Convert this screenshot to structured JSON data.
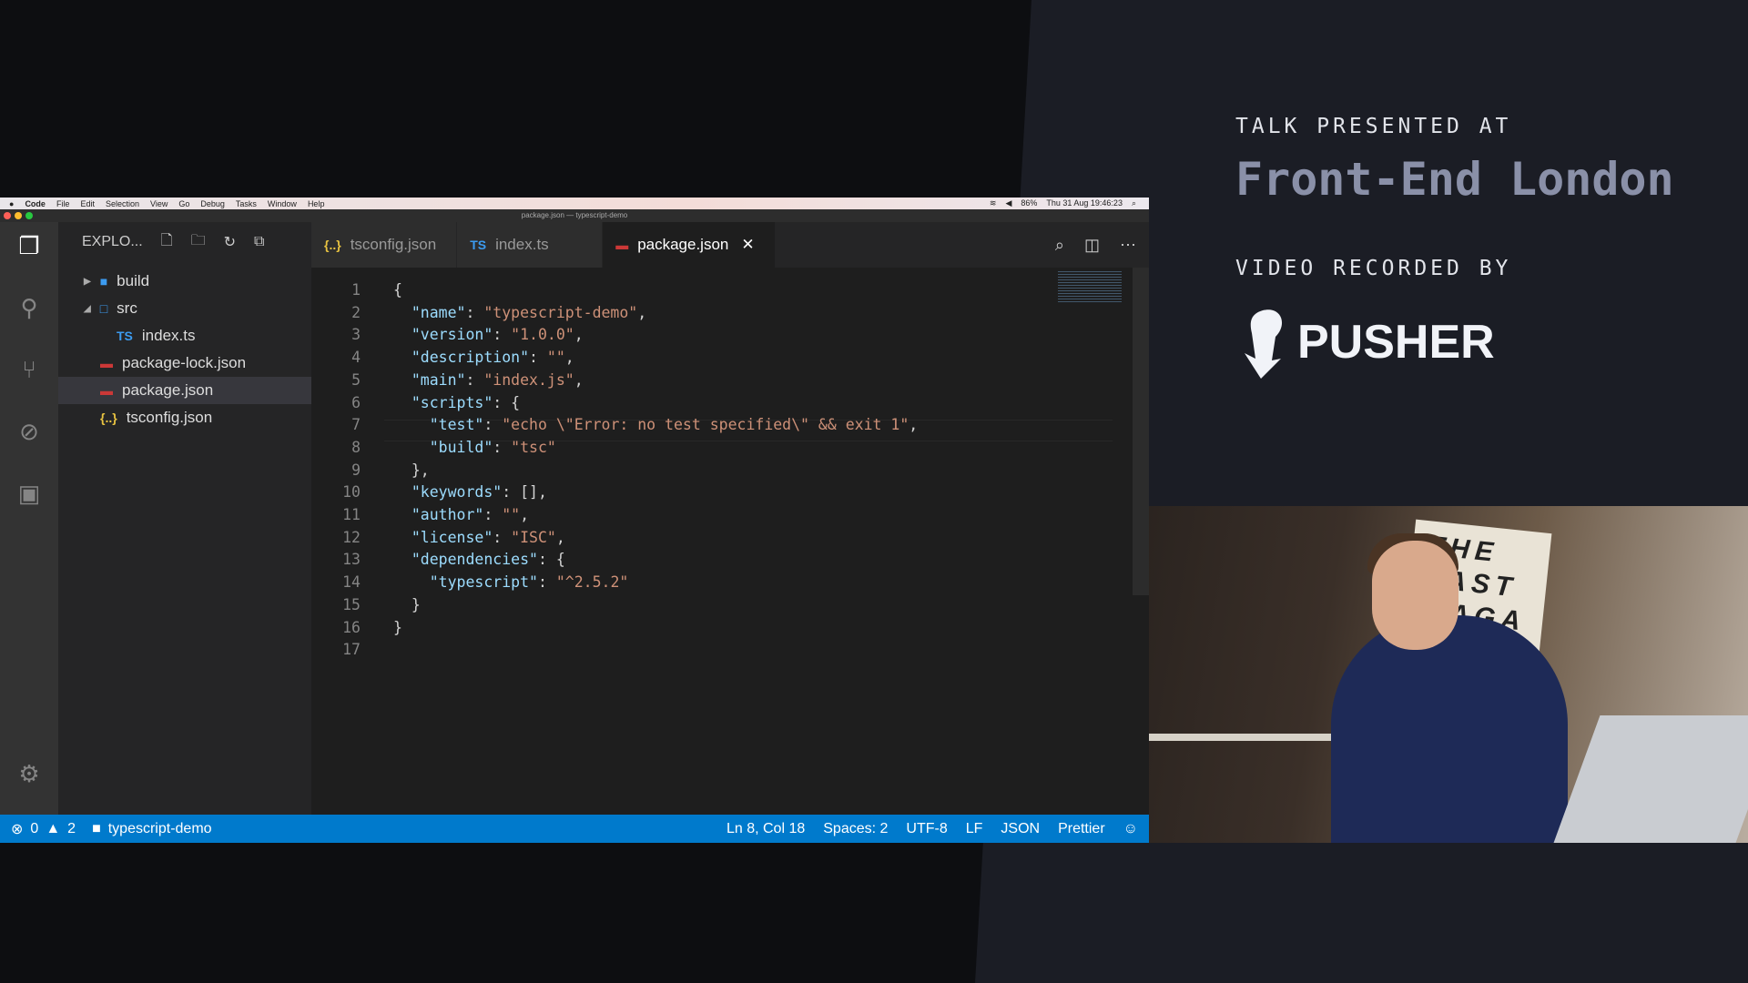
{
  "menubar": {
    "items": [
      "Code",
      "File",
      "Edit",
      "Selection",
      "View",
      "Go",
      "Debug",
      "Tasks",
      "Window",
      "Help"
    ],
    "battery": "86%",
    "clock": "Thu 31 Aug  19:46:23"
  },
  "window_title": "package.json — typescript-demo",
  "sidebar": {
    "title": "EXPLO...",
    "items": [
      {
        "label": "build",
        "icon": "folder-icon",
        "type": "folder",
        "expanded": false
      },
      {
        "label": "src",
        "icon": "folder-open-icon",
        "type": "folder",
        "expanded": true
      },
      {
        "label": "index.ts",
        "icon": "TS",
        "type": "file"
      },
      {
        "label": "package-lock.json",
        "icon": "npm-icon",
        "type": "file"
      },
      {
        "label": "package.json",
        "icon": "npm-icon",
        "type": "file",
        "selected": true
      },
      {
        "label": "tsconfig.json",
        "icon": "{..}",
        "type": "file"
      }
    ]
  },
  "tabs": [
    {
      "label": "tsconfig.json",
      "icon": "{..}"
    },
    {
      "label": "index.ts",
      "icon": "TS"
    },
    {
      "label": "package.json",
      "icon": "npm-icon",
      "active": true
    }
  ],
  "code": [
    "{",
    "  \"name\": \"typescript-demo\",",
    "  \"version\": \"1.0.0\",",
    "  \"description\": \"\",",
    "  \"main\": \"index.js\",",
    "  \"scripts\": {",
    "    \"test\": \"echo \\\"Error: no test specified\\\" && exit 1\",",
    "    \"build\": \"tsc\"",
    "  },",
    "  \"keywords\": [],",
    "  \"author\": \"\",",
    "  \"license\": \"ISC\",",
    "  \"dependencies\": {",
    "    \"typescript\": \"^2.5.2\"",
    "  }",
    "}",
    ""
  ],
  "status": {
    "errors": "0",
    "warnings": "2",
    "folder": "typescript-demo",
    "position": "Ln 8, Col 18",
    "spaces": "Spaces: 2",
    "encoding": "UTF-8",
    "eol": "LF",
    "language": "JSON",
    "formatter": "Prettier"
  },
  "overlay": {
    "talk_label": "TALK PRESENTED AT",
    "event": "Front-End London",
    "video_label": "VIDEO RECORDED BY",
    "sponsor": "PUSHER"
  },
  "video": {
    "sign_text": "THE LAST MAGA ZINE"
  },
  "colors": {
    "status_bar": "#007acc",
    "json_key": "#9cdcfe",
    "json_string": "#ce9178"
  }
}
